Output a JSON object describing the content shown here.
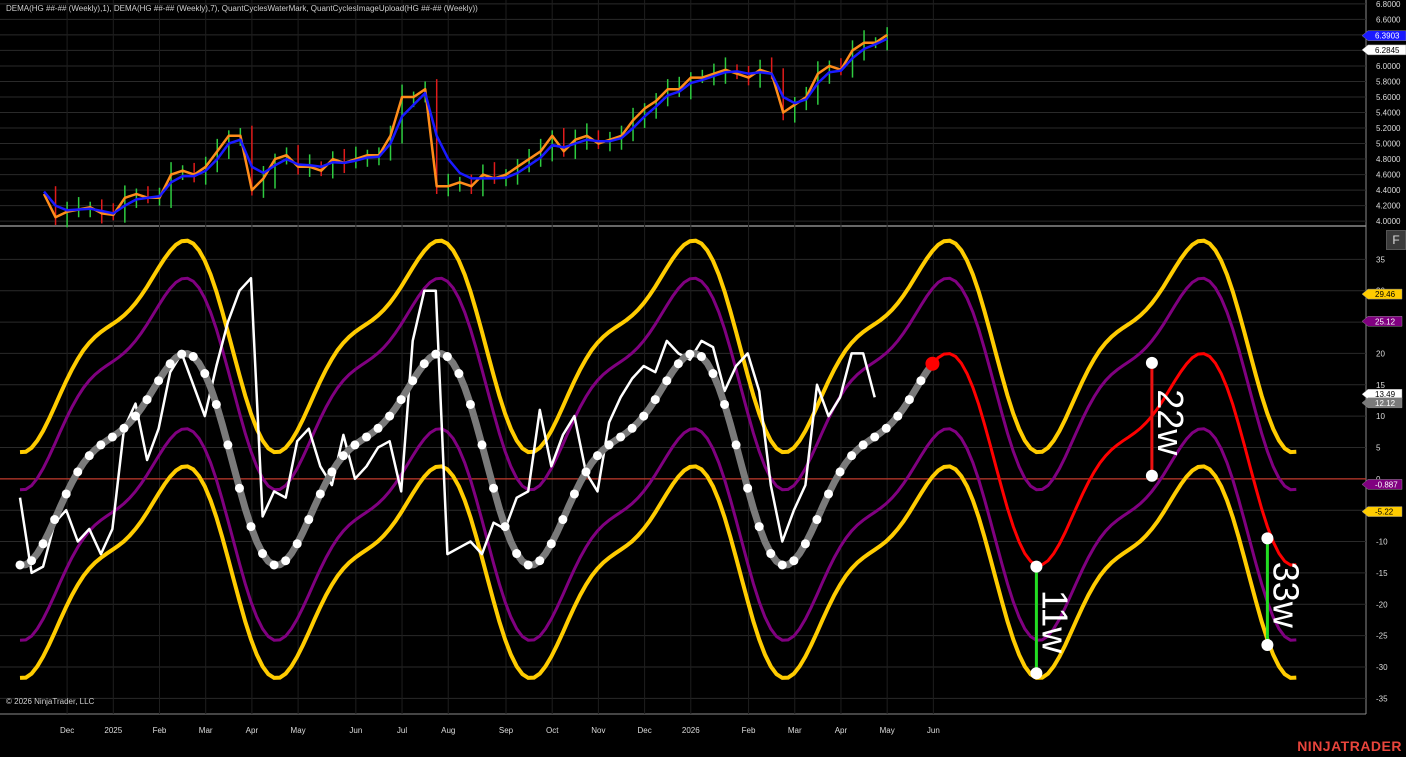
{
  "header_text": "DEMA(HG ##-## (Weekly),1), DEMA(HG ##-## (Weekly),7), QuantCyclesWaterMark, QuantCyclesImageUpload(HG ##-## (Weekly))",
  "copyright": "© 2026 NinjaTrader, LLC",
  "brand": "NINJATRADER",
  "f_button": "F",
  "colors": {
    "background": "#000000",
    "grid": "#2a2a2a",
    "fast_dema": "#ff8c1a",
    "slow_dema": "#1a1aff",
    "up_bar": "#2ecc40",
    "down_bar": "#e01b1b",
    "cycle_gold": "#ffcc00",
    "cycle_purple": "#800080",
    "composite": "#7a7a7a",
    "oscillator": "#ffffff",
    "projection": "#ff0000",
    "zero_line": "#c0392b",
    "marker_green": "#22dd22",
    "marker_red": "#ee1111"
  },
  "chart_data": [
    {
      "type": "line",
      "panel": "price",
      "ylim": [
        3.95,
        6.85
      ],
      "yticks": [
        "4.0000",
        "4.2000",
        "4.4000",
        "4.6000",
        "4.8000",
        "5.0000",
        "5.2000",
        "5.4000",
        "5.6000",
        "5.8000",
        "6.0000",
        "6.2000",
        "6.4000",
        "6.6000",
        "6.8000"
      ],
      "x_week_start": 0,
      "series": [
        {
          "role": "dema_fast",
          "values": [
            4.35,
            4.05,
            4.12,
            4.15,
            4.18,
            4.1,
            4.08,
            4.3,
            4.35,
            4.3,
            4.3,
            4.6,
            4.65,
            4.6,
            4.7,
            4.9,
            5.1,
            5.1,
            4.4,
            4.55,
            4.8,
            4.85,
            4.7,
            4.7,
            4.65,
            4.8,
            4.75,
            4.8,
            4.85,
            4.85,
            5.1,
            5.6,
            5.6,
            5.7,
            4.45,
            4.45,
            4.5,
            4.45,
            4.6,
            4.55,
            4.6,
            4.7,
            4.8,
            4.9,
            5.1,
            4.9,
            5.05,
            5.1,
            5.0,
            5.05,
            5.1,
            5.3,
            5.45,
            5.55,
            5.7,
            5.7,
            5.85,
            5.85,
            5.9,
            5.95,
            5.9,
            5.85,
            5.95,
            5.9,
            5.4,
            5.5,
            5.6,
            5.9,
            6.0,
            5.95,
            6.2,
            6.3,
            6.3,
            6.4
          ]
        },
        {
          "role": "dema_slow",
          "values": [
            4.38,
            4.2,
            4.14,
            4.15,
            4.16,
            4.13,
            4.1,
            4.2,
            4.28,
            4.3,
            4.32,
            4.5,
            4.58,
            4.58,
            4.65,
            4.8,
            5.0,
            5.05,
            4.7,
            4.62,
            4.72,
            4.8,
            4.73,
            4.72,
            4.7,
            4.76,
            4.75,
            4.78,
            4.82,
            4.83,
            5.0,
            5.35,
            5.5,
            5.65,
            5.1,
            4.8,
            4.62,
            4.55,
            4.55,
            4.55,
            4.56,
            4.62,
            4.72,
            4.82,
            4.98,
            4.95,
            5.0,
            5.05,
            5.03,
            5.03,
            5.07,
            5.2,
            5.35,
            5.48,
            5.62,
            5.67,
            5.78,
            5.82,
            5.87,
            5.92,
            5.93,
            5.9,
            5.92,
            5.9,
            5.6,
            5.52,
            5.57,
            5.78,
            5.92,
            5.94,
            6.1,
            6.22,
            6.28,
            6.35
          ]
        },
        {
          "role": "bars",
          "values": [
            4.35,
            4.05,
            4.12,
            4.15,
            4.18,
            4.1,
            4.08,
            4.3,
            4.35,
            4.3,
            4.3,
            4.6,
            4.65,
            4.6,
            4.7,
            4.9,
            5.1,
            5.1,
            4.4,
            4.55,
            4.8,
            4.85,
            4.7,
            4.7,
            4.65,
            4.8,
            4.75,
            4.8,
            4.85,
            4.85,
            5.1,
            5.6,
            5.6,
            5.7,
            4.45,
            4.45,
            4.5,
            4.45,
            4.6,
            4.55,
            4.6,
            4.7,
            4.8,
            4.9,
            5.1,
            4.9,
            5.05,
            5.1,
            5.0,
            5.05,
            5.1,
            5.3,
            5.45,
            5.55,
            5.7,
            5.7,
            5.85,
            5.85,
            5.9,
            5.95,
            5.9,
            5.85,
            5.95,
            5.9,
            5.4,
            5.5,
            5.6,
            5.9,
            6.0,
            5.95,
            6.2,
            6.3,
            6.3,
            6.4
          ]
        }
      ],
      "labels": [
        {
          "text": "6.3903",
          "value": 6.3903,
          "color": "#1a1aff"
        },
        {
          "text": "6.2845",
          "value": 6.2845,
          "color": "#ffffff"
        }
      ]
    },
    {
      "type": "line",
      "panel": "cycles",
      "ylim": [
        -37.5,
        40
      ],
      "yticks": [
        "35",
        "30",
        "25",
        "20",
        "15",
        "10",
        "5",
        "0",
        "-5",
        "-10",
        "-15",
        "-20",
        "-25",
        "-30",
        "-35"
      ],
      "months": [
        "Dec",
        "2025",
        "Feb",
        "Mar",
        "Apr",
        "May",
        "Jun",
        "Jul",
        "Aug",
        "Sep",
        "Oct",
        "Nov",
        "Dec",
        "2026",
        "Feb",
        "Mar",
        "Apr",
        "May",
        "Jun"
      ],
      "month_week_index": [
        2,
        6,
        10,
        14,
        18,
        22,
        27,
        31,
        35,
        40,
        44,
        48,
        52,
        56,
        61,
        65,
        69,
        73,
        77
      ],
      "oscillator": [
        -3,
        -15,
        -14,
        -7,
        -5,
        -10,
        -8,
        -12,
        -8,
        8,
        12,
        3,
        8,
        17,
        20,
        15,
        10,
        18,
        25,
        30,
        32,
        -6,
        -2,
        -3,
        6,
        8,
        2,
        -1,
        7,
        0,
        2,
        5,
        6,
        -2,
        22,
        30,
        30,
        -12,
        -11,
        -10,
        -12,
        -7,
        -8,
        -3,
        -2,
        11,
        2,
        7,
        10,
        1,
        -2,
        9,
        13,
        16,
        18,
        17,
        22,
        20,
        19,
        22,
        21,
        14,
        18,
        20,
        14,
        -1,
        -10,
        -5,
        -1,
        15,
        10,
        13,
        20,
        20,
        13
      ],
      "composite_end_week": 79,
      "projection_end_week": 109,
      "labels": [
        {
          "text": "29.46",
          "value": 29.46,
          "color": "#ffcc00"
        },
        {
          "text": "25.12",
          "value": 25.12,
          "color": "#800080"
        },
        {
          "text": "13.49",
          "value": 13.49,
          "color": "#ffffff"
        },
        {
          "text": "12.12",
          "value": 12.12,
          "color": "#7a7a7a"
        },
        {
          "text": "-0.887",
          "value": -0.887,
          "color": "#800080"
        },
        {
          "text": "-5.22",
          "value": -5.22,
          "color": "#ffcc00"
        }
      ],
      "annotations": [
        {
          "text": "11w",
          "week": 88,
          "from": -14,
          "to": -31,
          "color": "#22dd22"
        },
        {
          "text": "22w",
          "week": 98,
          "from": 18.5,
          "to": 0.5,
          "color": "#ee1111"
        },
        {
          "text": "33w",
          "week": 108,
          "from": -9.5,
          "to": -26.5,
          "color": "#22dd22"
        }
      ]
    }
  ]
}
